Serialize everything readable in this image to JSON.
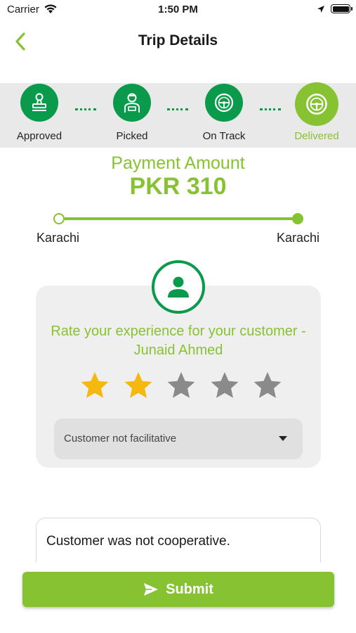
{
  "status_bar": {
    "carrier": "Carrier",
    "time": "1:50 PM"
  },
  "nav": {
    "title": "Trip Details",
    "back_icon": "chevron-left-icon"
  },
  "stepper": {
    "steps": [
      {
        "label": "Approved",
        "icon": "stamp-icon",
        "active": false
      },
      {
        "label": "Picked",
        "icon": "driver-icon",
        "active": false
      },
      {
        "label": "On Track",
        "icon": "steering-wheel-icon",
        "active": false
      },
      {
        "label": "Delivered",
        "icon": "steering-wheel-icon",
        "active": true
      }
    ]
  },
  "payment": {
    "label": "Payment Amount",
    "amount": "PKR 310"
  },
  "route": {
    "from": "Karachi",
    "to": "Karachi"
  },
  "rating": {
    "prompt": "Rate your experience for your customer - Junaid Ahmed",
    "stars_total": 5,
    "stars_selected": 2,
    "reason_selected": "Customer not facilitative"
  },
  "comment": {
    "value": "Customer was not cooperative."
  },
  "submit": {
    "label": "Submit",
    "icon": "send-icon"
  },
  "colors": {
    "brand_green": "#86c232",
    "dark_green": "#0a9a4b",
    "star_active": "#f5b80e",
    "star_inactive": "#8a8a8a"
  }
}
